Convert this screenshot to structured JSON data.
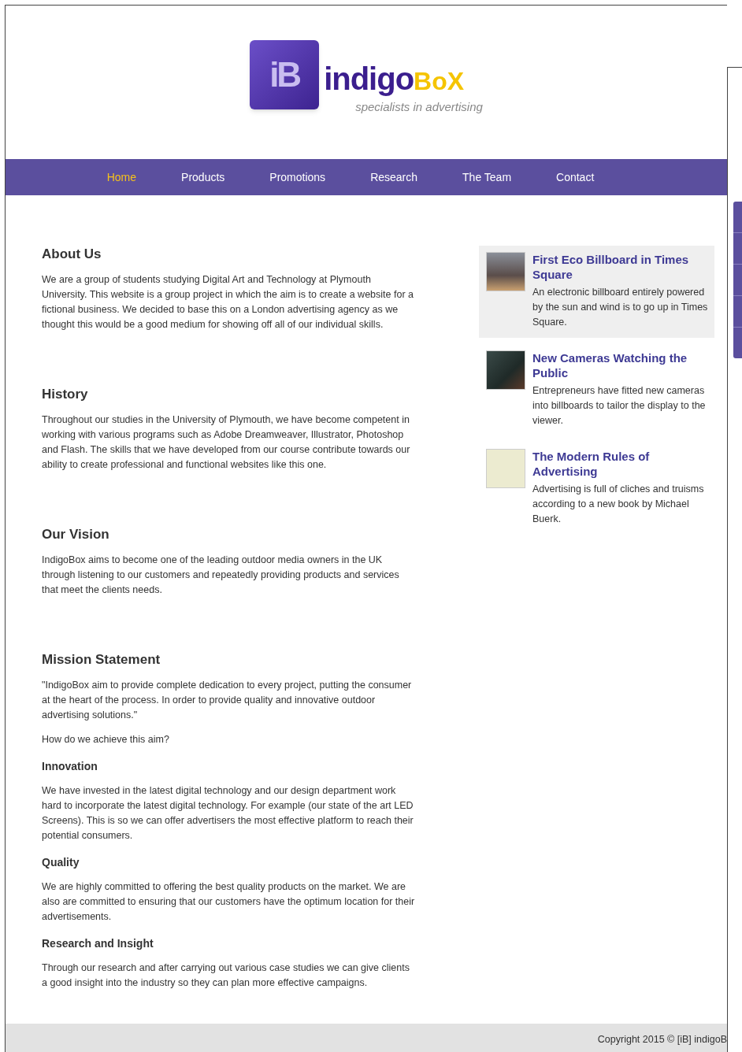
{
  "logo": {
    "cube_text": "iB",
    "name_main": "indigo",
    "name_accent": "BoX",
    "tagline": "specialists in advertising"
  },
  "nav": [
    {
      "label": "Home",
      "selected": true
    },
    {
      "label": "Products",
      "selected": false
    },
    {
      "label": "Promotions",
      "selected": false
    },
    {
      "label": "Research",
      "selected": false
    },
    {
      "label": "The Team",
      "selected": false
    },
    {
      "label": "Contact",
      "selected": false
    }
  ],
  "content": [
    {
      "kind": "heading",
      "text": "About Us"
    },
    {
      "kind": "paragraph",
      "text": "We are a group of students studying Digital Art and Technology at Plymouth University. This website is a group project in which the aim is to create a website for a fictional business. We decided to base this on a London advertising agency as we thought this would be a good medium for showing off all of our individual skills."
    },
    {
      "kind": "heading",
      "text": "History"
    },
    {
      "kind": "paragraph",
      "text": "Throughout our studies in the University of Plymouth, we have become competent in working with various programs such as Adobe Dreamweaver, Illustrator, Photoshop and Flash. The skills that we have developed from our course contribute towards our ability to create professional and functional websites like this one."
    },
    {
      "kind": "heading",
      "text": "Our Vision"
    },
    {
      "kind": "paragraph",
      "text": "IndigoBox aims to become one of the leading outdoor media owners in the UK through listening to our customers and repeatedly providing products and services that meet the clients needs."
    },
    {
      "kind": "heading",
      "text": "Mission Statement"
    },
    {
      "kind": "paragraph",
      "text": "\"IndigoBox aim to provide complete dedication to every project, putting the consumer at the heart of the process. In order to provide quality and innovative outdoor advertising solutions.\""
    },
    {
      "kind": "paragraph",
      "text": "How do we achieve this aim?"
    },
    {
      "kind": "subheading",
      "text": "Innovation"
    },
    {
      "kind": "paragraph",
      "text": "We have invested in the latest digital technology and our design department work hard to incorporate the latest digital technology. For example (our state of the art LED Screens). This is so we can offer advertisers the most effective platform to reach their potential consumers."
    },
    {
      "kind": "subheading",
      "text": "Quality"
    },
    {
      "kind": "paragraph",
      "text": "We are highly committed to offering the best quality products on the market. We are also are committed to ensuring that our customers have the optimum location for their advertisements."
    },
    {
      "kind": "subheading",
      "text": "Research and Insight"
    },
    {
      "kind": "paragraph",
      "text": "Through our research and after carrying out various case studies we can give clients a good insight into the industry so they can plan more effective campaigns."
    }
  ],
  "news": [
    {
      "title": "First Eco Billboard in Times Square",
      "summary": "An electronic billboard entirely powered by the sun and wind is to go up in Times Square.",
      "selected": true
    },
    {
      "title": "New Cameras Watching the Public",
      "summary": "Entrepreneurs have fitted new cameras into billboards to tailor the display to the viewer.",
      "selected": false
    },
    {
      "title": "The Modern Rules of Advertising",
      "summary": "Advertising is full of cliches and truisms according to a new book by Michael Buerk.",
      "selected": false
    }
  ],
  "footer": {
    "copyright": "Copyright 2015 © [iB] indigoB"
  }
}
